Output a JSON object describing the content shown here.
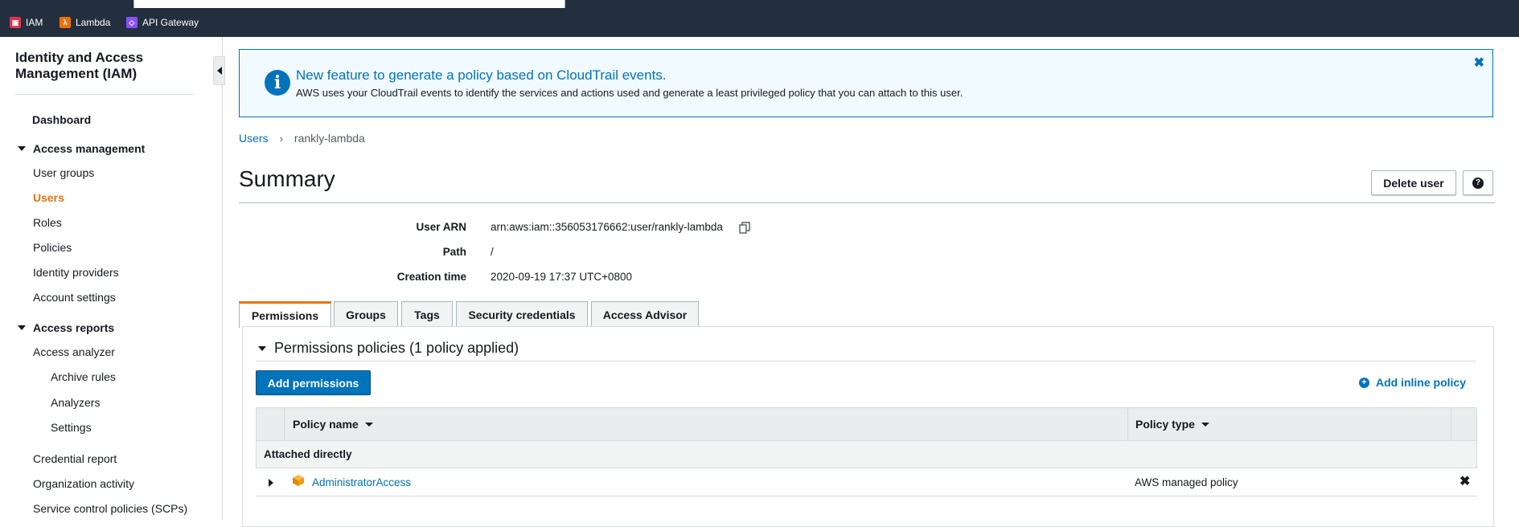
{
  "favorites": [
    {
      "label": "IAM",
      "icon": "iam-icon",
      "color": "#dd344c"
    },
    {
      "label": "Lambda",
      "icon": "lambda-icon",
      "color": "#ed7100"
    },
    {
      "label": "API Gateway",
      "icon": "api-gateway-icon",
      "color": "#8c4fff"
    }
  ],
  "sidebar": {
    "title": "Identity and Access Management (IAM)",
    "dashboard": "Dashboard",
    "access_management": "Access management",
    "am_items": [
      "User groups",
      "Users",
      "Roles",
      "Policies",
      "Identity providers",
      "Account settings"
    ],
    "active_item": "Users",
    "access_reports": "Access reports",
    "ar_items": [
      "Access analyzer",
      "Archive rules",
      "Analyzers",
      "Settings",
      "Credential report",
      "Organization activity",
      "Service control policies (SCPs)"
    ]
  },
  "banner": {
    "title": "New feature to generate a policy based on CloudTrail events.",
    "body": "AWS uses your CloudTrail events to identify the services and actions used and generate a least privileged policy that you can attach to this user.",
    "close": "✖"
  },
  "breadcrumb": {
    "parent": "Users",
    "separator": "›",
    "current": "rankly-lambda"
  },
  "summary": {
    "title": "Summary",
    "delete_button": "Delete user",
    "help_button": "?",
    "fields": [
      {
        "label": "User ARN",
        "value": "arn:aws:iam::356053176662:user/rankly-lambda"
      },
      {
        "label": "Path",
        "value": "/"
      },
      {
        "label": "Creation time",
        "value": "2020-09-19 17:37 UTC+0800"
      }
    ]
  },
  "tabs": [
    "Permissions",
    "Groups",
    "Tags",
    "Security credentials",
    "Access Advisor"
  ],
  "active_tab": "Permissions",
  "permissions": {
    "section_title": "Permissions policies (1 policy applied)",
    "add_permissions": "Add permissions",
    "add_inline": "Add inline policy",
    "columns": [
      "Policy name",
      "Policy type"
    ],
    "group_label": "Attached directly",
    "rows": [
      {
        "name": "AdministratorAccess",
        "type": "AWS managed policy",
        "remove": "✖"
      }
    ]
  },
  "colors": {
    "accent": "#ec7211",
    "link": "#0073bb",
    "nav_bg": "#232f3e"
  }
}
